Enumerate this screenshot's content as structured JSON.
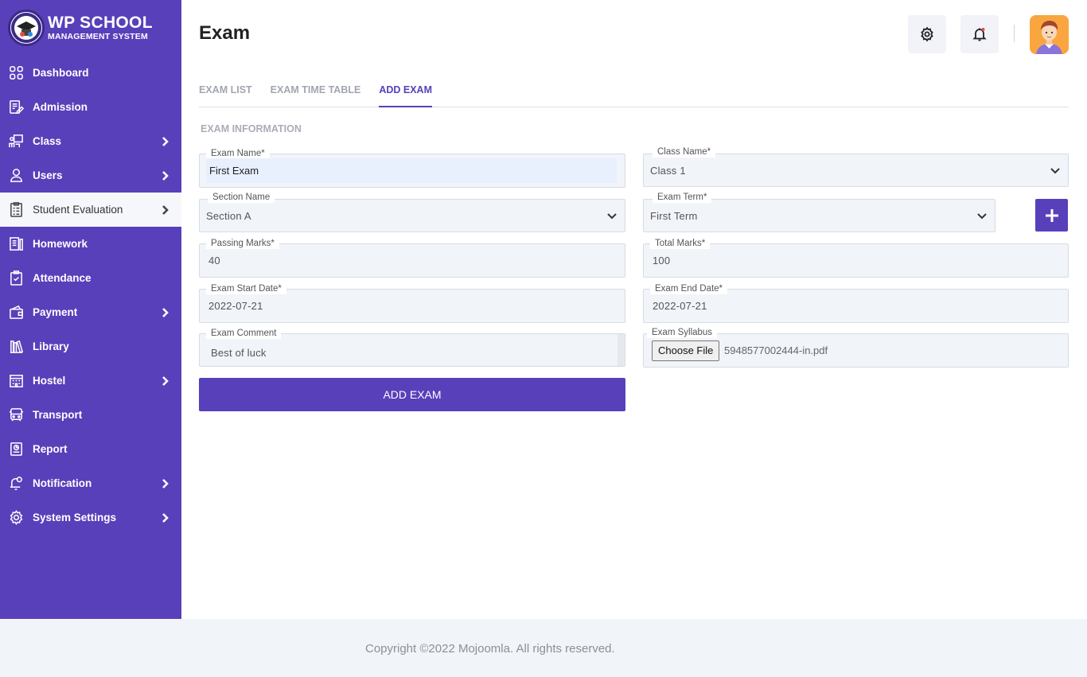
{
  "brand": {
    "title": "WP SCHOOL",
    "subtitle": "MANAGEMENT SYSTEM"
  },
  "sidebar": {
    "items": [
      {
        "label": "Dashboard",
        "icon": "dashboard-icon"
      },
      {
        "label": "Admission",
        "icon": "admission-icon"
      },
      {
        "label": "Class",
        "icon": "class-icon",
        "has_submenu": true
      },
      {
        "label": "Users",
        "icon": "user-icon",
        "has_submenu": true
      },
      {
        "label": "Student Evaluation",
        "icon": "evaluation-icon",
        "has_submenu": true,
        "active": true
      },
      {
        "label": "Homework",
        "icon": "homework-icon"
      },
      {
        "label": "Attendance",
        "icon": "attendance-icon"
      },
      {
        "label": "Payment",
        "icon": "wallet-icon",
        "has_submenu": true
      },
      {
        "label": "Library",
        "icon": "library-icon"
      },
      {
        "label": "Hostel",
        "icon": "hostel-icon",
        "has_submenu": true
      },
      {
        "label": "Transport",
        "icon": "bus-icon"
      },
      {
        "label": "Report",
        "icon": "report-icon"
      },
      {
        "label": "Notification",
        "icon": "notification-icon",
        "has_submenu": true
      },
      {
        "label": "System Settings",
        "icon": "gear-icon",
        "has_submenu": true
      }
    ]
  },
  "header": {
    "title": "Exam"
  },
  "tabs": [
    {
      "label": "EXAM LIST"
    },
    {
      "label": "EXAM TIME TABLE"
    },
    {
      "label": "ADD EXAM",
      "active": true
    }
  ],
  "form": {
    "section_title": "EXAM INFORMATION",
    "exam_name": {
      "label": "Exam Name*",
      "value": "First Exam"
    },
    "class_name": {
      "label": "Class Name*",
      "value": "Class 1"
    },
    "section_name": {
      "label": "Section Name",
      "value": "Section A"
    },
    "exam_term": {
      "label": "Exam Term*",
      "value": "First Term"
    },
    "passing_marks": {
      "label": "Passing Marks*",
      "value": "40"
    },
    "total_marks": {
      "label": "Total Marks*",
      "value": "100"
    },
    "start_date": {
      "label": "Exam Start Date*",
      "value": "2022-07-21"
    },
    "end_date": {
      "label": "Exam End Date*",
      "value": "2022-07-21"
    },
    "comment": {
      "label": "Exam Comment",
      "value": "Best of luck"
    },
    "syllabus": {
      "label": "Exam Syllabus",
      "button": "Choose File",
      "file": "5948577002444-in.pdf"
    },
    "submit_label": "ADD EXAM"
  },
  "footer": {
    "text": "Copyright ©2022 Mojoomla. All rights reserved."
  },
  "colors": {
    "primary": "#5840bb",
    "field_bg": "#f1f4f9",
    "page_bg": "#ffffff",
    "footer_bg": "#f1f4f9"
  }
}
